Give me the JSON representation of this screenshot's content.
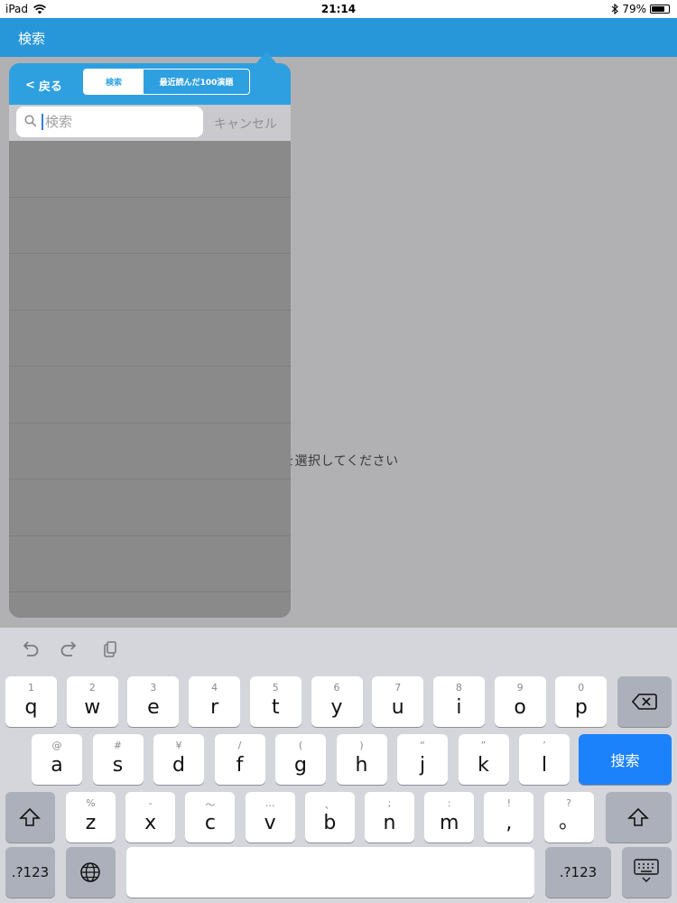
{
  "status_bar": {
    "device": "iPad",
    "time": "21:14",
    "battery": "79%",
    "battery_level": 0.79
  },
  "nav": {
    "title": "検索"
  },
  "main": {
    "message": "を選択してください"
  },
  "popover": {
    "back_label": "戻る",
    "segments": [
      "検索",
      "最近読んだ100演題"
    ],
    "search": {
      "placeholder": "検索",
      "value": ""
    },
    "cancel_label": "キャンセル"
  },
  "keyboard": {
    "row1": [
      {
        "hint": "1",
        "key": "q"
      },
      {
        "hint": "2",
        "key": "w"
      },
      {
        "hint": "3",
        "key": "e"
      },
      {
        "hint": "4",
        "key": "r"
      },
      {
        "hint": "5",
        "key": "t"
      },
      {
        "hint": "6",
        "key": "y"
      },
      {
        "hint": "7",
        "key": "u"
      },
      {
        "hint": "8",
        "key": "i"
      },
      {
        "hint": "9",
        "key": "o"
      },
      {
        "hint": "0",
        "key": "p"
      }
    ],
    "row2": [
      {
        "hint": "@",
        "key": "a"
      },
      {
        "hint": "#",
        "key": "s"
      },
      {
        "hint": "¥",
        "key": "d"
      },
      {
        "hint": "/",
        "key": "f"
      },
      {
        "hint": "(",
        "key": "g"
      },
      {
        "hint": ")",
        "key": "h"
      },
      {
        "hint": "“",
        "key": "j"
      },
      {
        "hint": "”",
        "key": "k"
      },
      {
        "hint": "’",
        "key": "l"
      }
    ],
    "row3": [
      {
        "hint": "%",
        "key": "z"
      },
      {
        "hint": "-",
        "key": "x"
      },
      {
        "hint": "〜",
        "key": "c"
      },
      {
        "hint": "…",
        "key": "v"
      },
      {
        "hint": "、",
        "key": "b"
      },
      {
        "hint": ";",
        "key": "n"
      },
      {
        "hint": ":",
        "key": "m"
      },
      {
        "hint": "!",
        "key": ","
      },
      {
        "hint": "?",
        "key": "。"
      }
    ],
    "search_key": "搜索",
    "num_key": ".?123"
  }
}
